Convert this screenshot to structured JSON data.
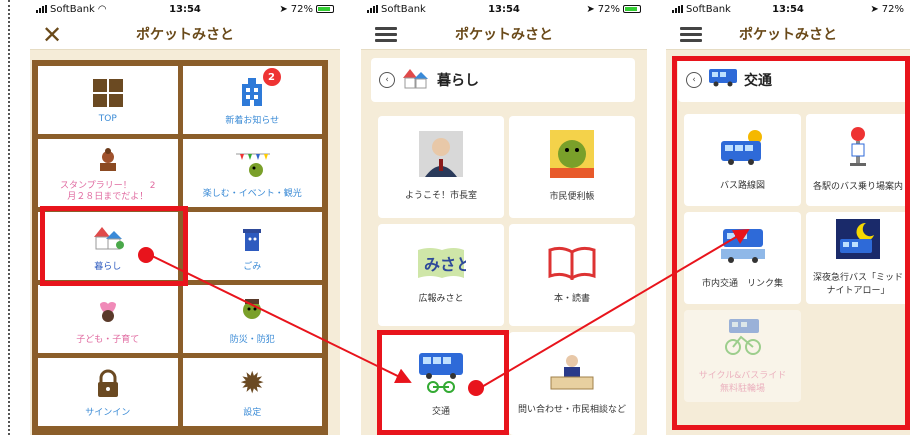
{
  "status": {
    "carrier": "SoftBank",
    "time": "13:54",
    "battery": "72%"
  },
  "app_title": "ポケットみさと",
  "menu": {
    "badge_count": "2",
    "items": [
      {
        "label": "TOP",
        "icon": "grid-icon"
      },
      {
        "label": "新着お知らせ",
        "icon": "building-icon"
      },
      {
        "label": "スタンプラリー！　　2\n月２８日までだよ！",
        "icon": "stamp-icon"
      },
      {
        "label": "楽しむ・イベント・観光",
        "icon": "festival-icon"
      },
      {
        "label": "暮らし",
        "icon": "house-icon"
      },
      {
        "label": "ごみ",
        "icon": "trash-icon"
      },
      {
        "label": "子ども・子育て",
        "icon": "heart-mascot-icon"
      },
      {
        "label": "防災・防犯",
        "icon": "mascot-icon"
      },
      {
        "label": "サインイン",
        "icon": "lock-icon"
      },
      {
        "label": "設定",
        "icon": "gear-icon"
      }
    ]
  },
  "kurashi": {
    "title": "暮らし",
    "items": [
      {
        "label": "ようこそ！市長室"
      },
      {
        "label": "市民便利帳"
      },
      {
        "label": "広報みさと"
      },
      {
        "label": "本・読書"
      },
      {
        "label": "交通"
      },
      {
        "label": "問い合わせ・市民相談など"
      }
    ]
  },
  "koutsu": {
    "title": "交通",
    "items": [
      {
        "label": "バス路線図"
      },
      {
        "label": "各駅のバス乗り場案内"
      },
      {
        "label": "市内交通　リンク集"
      },
      {
        "label": "深夜急行バス「ミッドナイトアロー」"
      },
      {
        "label": "サイクル&バスライド\n無料駐輪場"
      }
    ]
  },
  "colors": {
    "highlight": "#e8141c",
    "frame": "#8b5e2a",
    "link": "#3b8bd6"
  }
}
